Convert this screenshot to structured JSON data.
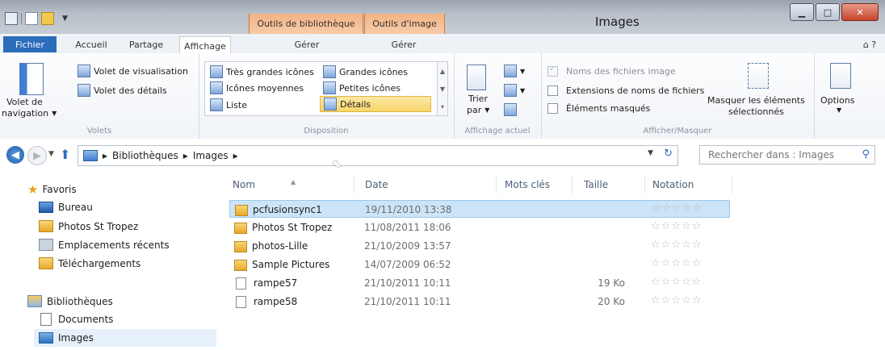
{
  "window": {
    "title": "Images",
    "context_lib": "Outils de bibliothèque",
    "context_img": "Outils d'image"
  },
  "tabs": {
    "file": "Fichier",
    "home": "Accueil",
    "share": "Partage",
    "view": "Affichage",
    "manage1": "Gérer",
    "manage2": "Gérer"
  },
  "ribbon": {
    "panes": {
      "nav_line1": "Volet de",
      "nav_line2": "navigation",
      "preview": "Volet de visualisation",
      "details": "Volet des détails",
      "label": "Volets"
    },
    "layout": {
      "items": [
        "Très grandes icônes",
        "Grandes icônes",
        "Icônes moyennes",
        "Petites icônes",
        "Liste",
        "Détails"
      ],
      "selected": "Détails",
      "label": "Disposition"
    },
    "current_view": {
      "sort_line1": "Trier",
      "sort_line2": "par",
      "label": "Affichage actuel"
    },
    "show_hide": {
      "item_names": "Noms des fichiers image",
      "extensions": "Extensions de noms de fichiers",
      "hidden": "Éléments masqués",
      "hide_selected_line1": "Masquer les éléments",
      "hide_selected_line2": "sélectionnés",
      "label": "Afficher/Masquer"
    },
    "options": "Options"
  },
  "address": {
    "crumb1": "Bibliothèques",
    "crumb2": "Images",
    "search_placeholder": "Rechercher dans : Images"
  },
  "nav": {
    "favorites": "Favoris",
    "desktop": "Bureau",
    "photos": "Photos St Tropez",
    "recent": "Emplacements récents",
    "downloads": "Téléchargements",
    "libraries": "Bibliothèques",
    "documents": "Documents",
    "images": "Images"
  },
  "columns": {
    "name": "Nom",
    "date": "Date",
    "tags": "Mots clés",
    "size": "Taille",
    "rating": "Notation"
  },
  "files": [
    {
      "name": "pcfusionsync1",
      "date": "19/11/2010 13:38",
      "size": "",
      "type": "folder",
      "rating": "☆☆☆☆☆"
    },
    {
      "name": "Photos St Tropez",
      "date": "11/08/2011 18:06",
      "size": "",
      "type": "folder",
      "rating": "☆☆☆☆☆"
    },
    {
      "name": "photos-Lille",
      "date": "21/10/2009 13:57",
      "size": "",
      "type": "folder",
      "rating": "☆☆☆☆☆"
    },
    {
      "name": "Sample Pictures",
      "date": "14/07/2009 06:52",
      "size": "",
      "type": "folder",
      "rating": "☆☆☆☆☆"
    },
    {
      "name": "rampe57",
      "date": "21/10/2011 10:11",
      "size": "19 Ko",
      "type": "file",
      "rating": "☆☆☆☆☆"
    },
    {
      "name": "rampe58",
      "date": "21/10/2011 10:11",
      "size": "20 Ko",
      "type": "file",
      "rating": "☆☆☆☆☆"
    }
  ]
}
